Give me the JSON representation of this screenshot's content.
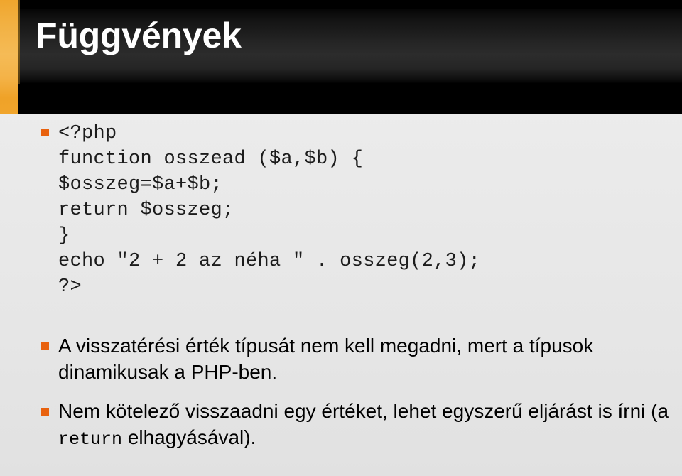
{
  "slide": {
    "title": "Függvények",
    "accent_color": "#f0a62d",
    "bullet_color": "#e8610e",
    "header_color": "#000000",
    "body_background": "#eaeaea",
    "text_color": "#000000"
  },
  "content": {
    "code_bullet": {
      "marker": "square-bullet-icon",
      "lines": [
        "<?php",
        "function osszead ($a,$b) {",
        "$osszeg=$a+$b;",
        "return $osszeg;",
        "}",
        "echo \"2 + 2 az néha \" . osszeg(2,3);",
        "?>"
      ]
    },
    "bullets": [
      {
        "marker": "square-bullet-icon",
        "segments": [
          {
            "text": "A visszatérési érték típusát nem kell megadni, mert a típusok dinamikusak a PHP-ben.",
            "style": "normal"
          }
        ]
      },
      {
        "marker": "square-bullet-icon",
        "segments": [
          {
            "text": "Nem kötelező visszaadni egy értéket, lehet egyszerű eljárást is írni (a ",
            "style": "normal"
          },
          {
            "text": "return",
            "style": "mono"
          },
          {
            "text": " elhagyásával).",
            "style": "normal"
          }
        ]
      }
    ]
  }
}
